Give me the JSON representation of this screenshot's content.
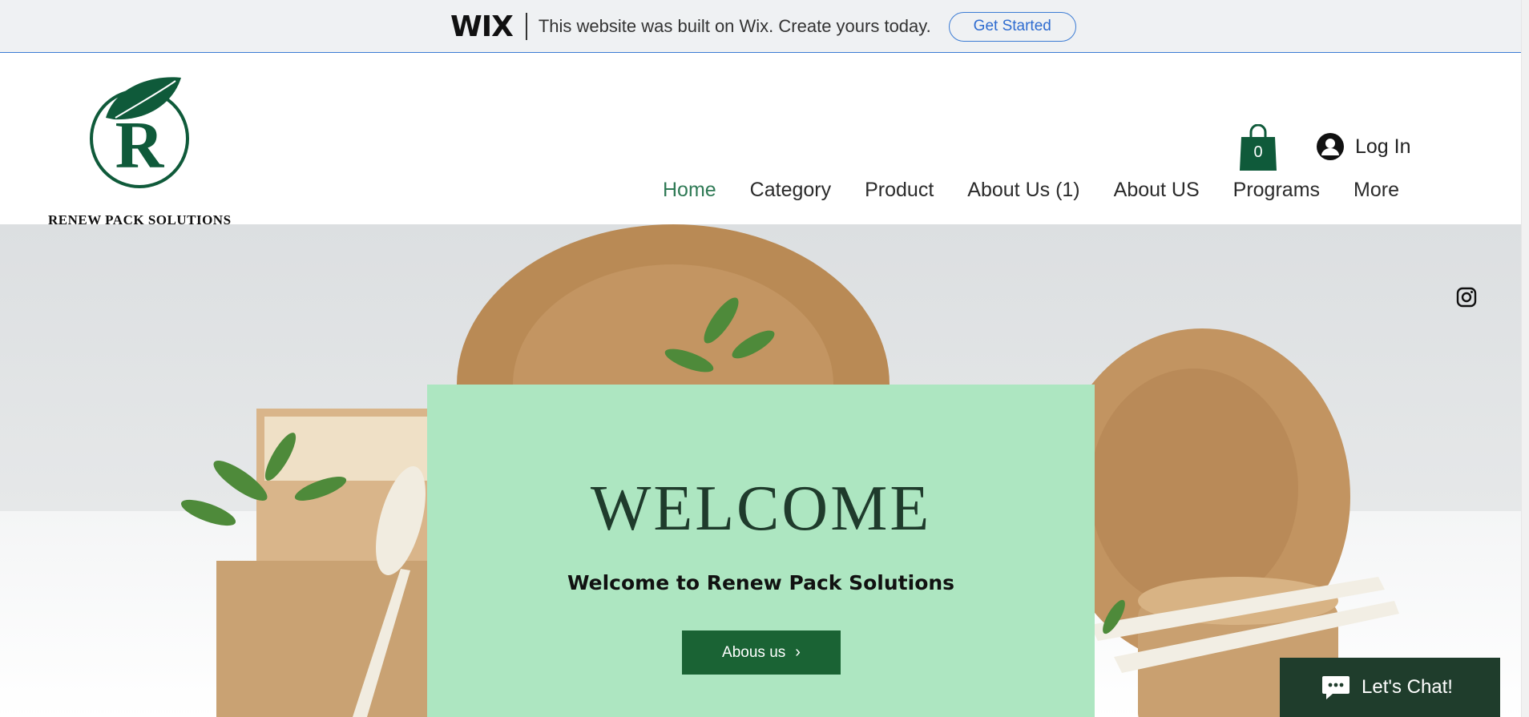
{
  "wix_banner": {
    "logo": "WIX",
    "message": "This website was built on Wix. Create yours today.",
    "cta": "Get Started"
  },
  "header": {
    "brand_name": "RENEW PACK SOLUTIONS",
    "logo_letter": "R",
    "cart_count": "0",
    "login_label": "Log In",
    "nav": [
      {
        "label": "Home",
        "active": true
      },
      {
        "label": "Category"
      },
      {
        "label": "Product"
      },
      {
        "label": "About Us (1)"
      },
      {
        "label": "About US"
      },
      {
        "label": "Programs"
      },
      {
        "label": "More"
      }
    ]
  },
  "hero": {
    "title": "WELCOME",
    "subtitle": "Welcome to Renew Pack Solutions",
    "button_label": "Abous us",
    "button_chevron": "›"
  },
  "chat": {
    "label": "Let's Chat!"
  },
  "colors": {
    "brand_green": "#0f5a3a",
    "nav_active": "#2f7a55",
    "card_bg": "#ade6c1",
    "button_bg": "#1a6334",
    "chat_bg": "#1f3d2c",
    "wix_blue": "#3b7bd4"
  },
  "icons": [
    "leaf-logo-icon",
    "shopping-bag-icon",
    "user-avatar-icon",
    "instagram-icon",
    "chat-bubble-icon",
    "chevron-right-icon"
  ]
}
